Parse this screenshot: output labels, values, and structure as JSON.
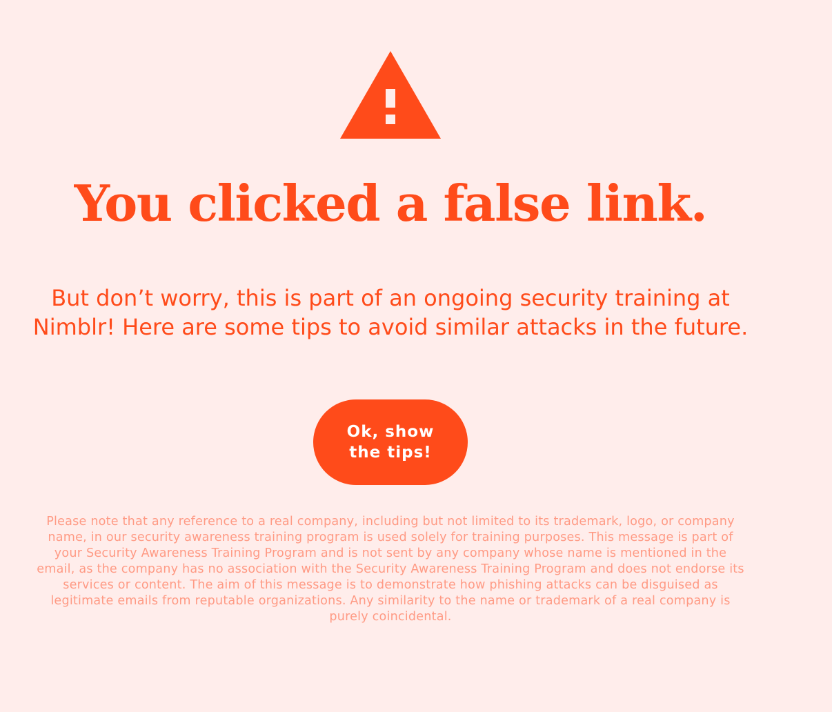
{
  "colors": {
    "accent": "#FF4B1A",
    "background": "#FFEDEB",
    "button_text": "#FFFFFF",
    "disclaimer": "#FF9A84"
  },
  "alert": {
    "icon": "warning-triangle-icon",
    "headline": "You clicked a false link.",
    "message": "But don’t worry, this is part of an ongoing security training at Nimblr! Here are some tips to avoid similar attacks in the future."
  },
  "cta": {
    "label": "Ok, show the tips!"
  },
  "disclaimer": {
    "text": "Please note that any reference to a real company, including but not limited to its trademark, logo, or company name, in our security awareness training program is used solely for training purposes. This message is part of your Security Awareness Training Program and is not sent by any company whose name is mentioned in the email, as the company has no association with the Security Awareness Training Program and does not endorse its services or content. The aim of this message is to demonstrate how phishing attacks can be disguised as legitimate emails from reputable organizations. Any similarity to the name or trademark of a real company is purely coincidental."
  }
}
